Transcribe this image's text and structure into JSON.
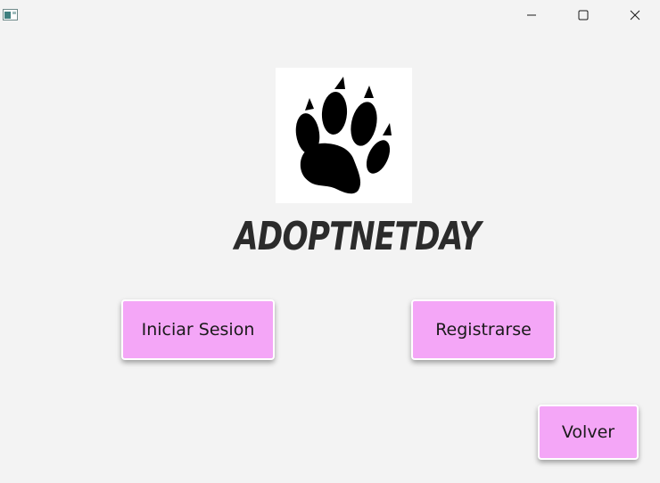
{
  "window": {
    "app_icon": "java-window-icon",
    "controls": {
      "minimize_icon": "minimize-icon",
      "maximize_icon": "maximize-icon",
      "close_icon": "close-icon"
    }
  },
  "logo": {
    "icon": "paw-print-icon"
  },
  "title": "ADOPTNETDAY",
  "buttons": {
    "login_label": "Iniciar Sesion",
    "register_label": "Registrarse",
    "back_label": "Volver"
  },
  "colors": {
    "button_bg": "#f4a6f7",
    "window_bg": "#f3f3f3"
  }
}
